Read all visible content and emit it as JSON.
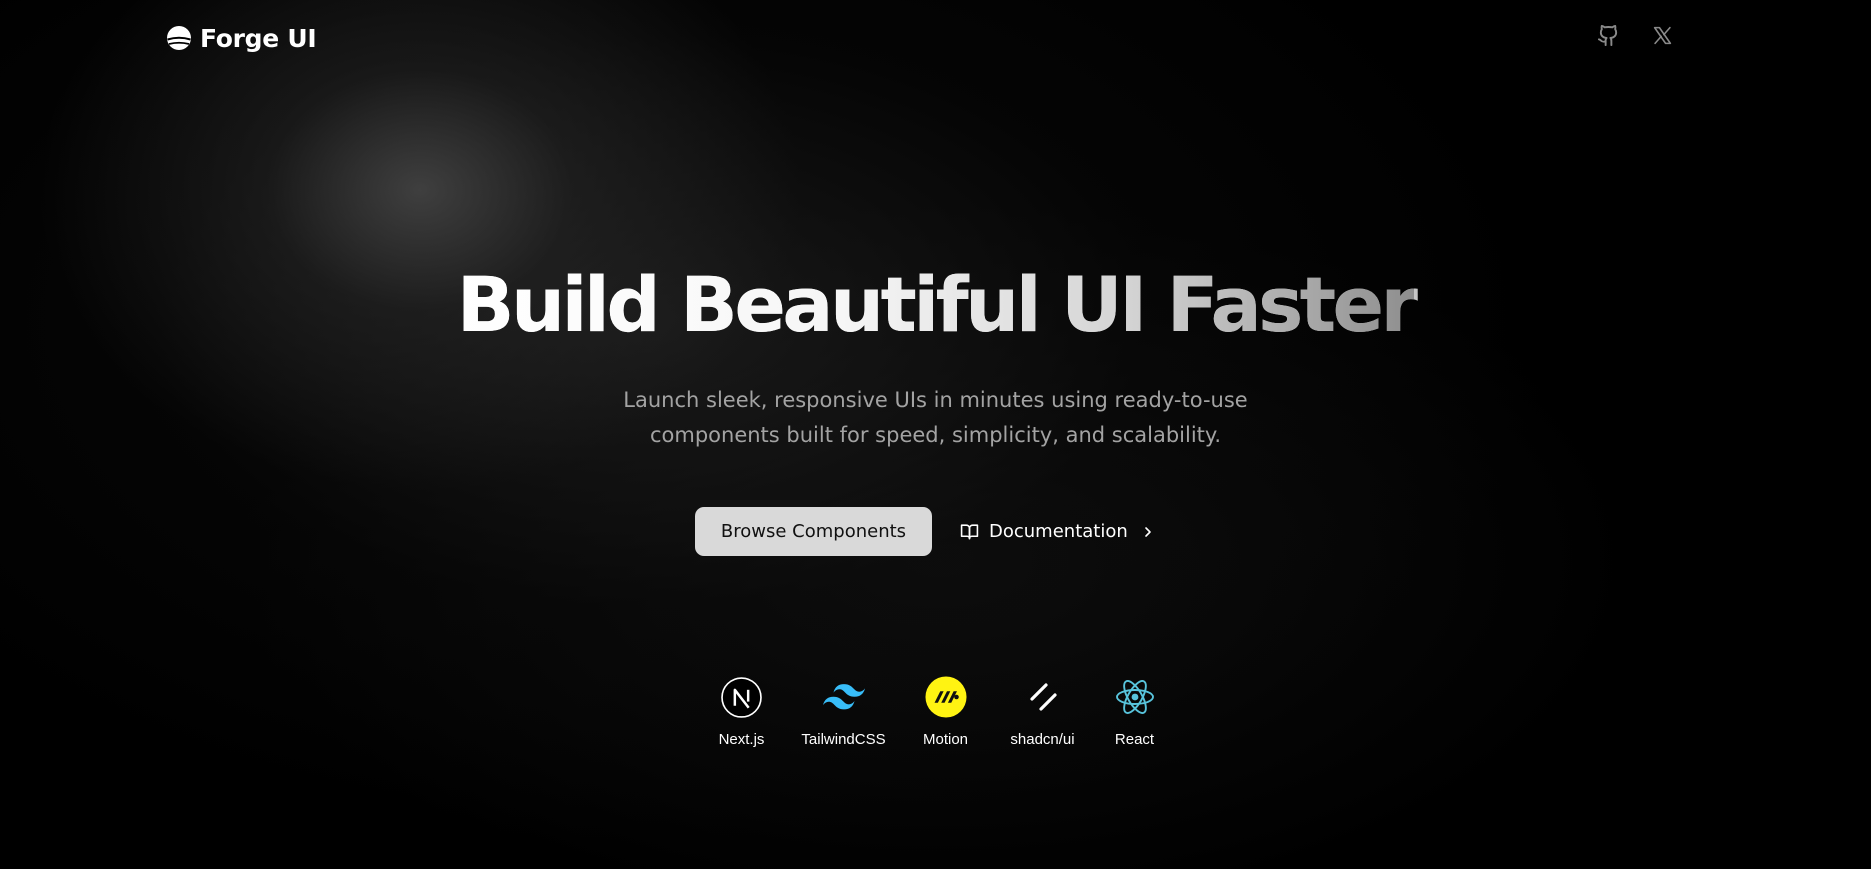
{
  "brand": {
    "name": "Forge UI",
    "logo_icon": "forge-globe-icon"
  },
  "header": {
    "icons": [
      {
        "name": "github-icon"
      },
      {
        "name": "x-icon"
      }
    ]
  },
  "hero": {
    "title": "Build Beautiful UI Faster",
    "subtitle_line1": "Launch sleek, responsive UIs in minutes using ready-to-use",
    "subtitle_line2": "components built for speed, simplicity, and scalability."
  },
  "cta": {
    "primary_label": "Browse Components",
    "secondary_label": "Documentation",
    "secondary_icon": "book-open-icon",
    "secondary_arrow_icon": "chevron-right-icon"
  },
  "tech_stack": [
    {
      "label": "Next.js",
      "icon": "nextjs-icon"
    },
    {
      "label": "TailwindCSS",
      "icon": "tailwindcss-icon",
      "color": "#38bdf8"
    },
    {
      "label": "Motion",
      "icon": "motion-icon",
      "color": "#fff312"
    },
    {
      "label": "shadcn/ui",
      "icon": "shadcn-icon"
    },
    {
      "label": "React",
      "icon": "react-icon",
      "color": "#58c4dc"
    }
  ],
  "colors": {
    "background": "#000000",
    "primary_button": "#d9d9d9",
    "subtitle": "#a3a3a3"
  }
}
